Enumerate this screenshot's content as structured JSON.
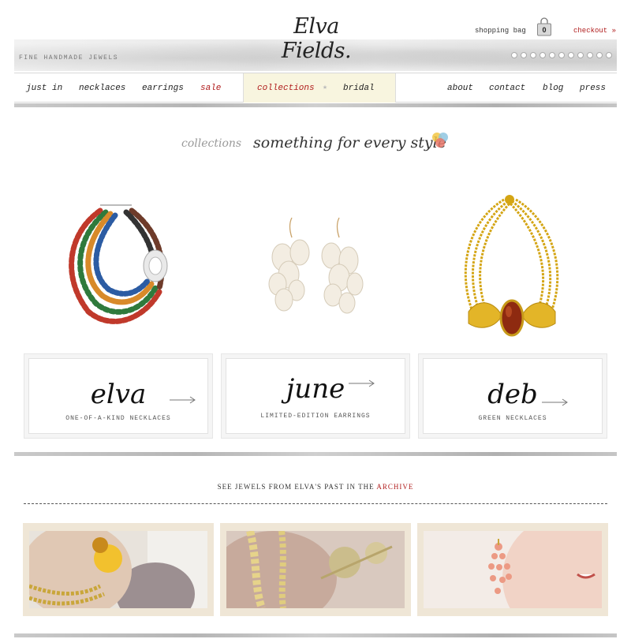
{
  "header": {
    "logo": "Elva Fields.",
    "tagline": "FINE HANDMADE JEWELS",
    "shopping_bag_label": "shopping bag",
    "bag_count": "0",
    "checkout_label": "checkout »"
  },
  "nav": {
    "left": [
      "just in",
      "necklaces",
      "earrings",
      "sale"
    ],
    "middle": [
      "collections",
      "bridal"
    ],
    "right": [
      "about",
      "contact",
      "blog",
      "press"
    ]
  },
  "collections": {
    "label": "collections",
    "title": "something for every style"
  },
  "products": [
    {
      "name": "elva",
      "subtitle": "ONE-OF-A-KIND NECKLACES"
    },
    {
      "name": "june",
      "subtitle": "LIMITED-EDITION EARRINGS"
    },
    {
      "name": "deb",
      "subtitle": "GREEN NECKLACES"
    }
  ],
  "archive": {
    "text": "SEE JEWELS FROM ELVA'S PAST IN THE",
    "link": "ARCHIVE"
  },
  "colors": {
    "accent_red": "#b01c1c",
    "nav_highlight": "#f8f5df",
    "gold": "#d4a514"
  }
}
